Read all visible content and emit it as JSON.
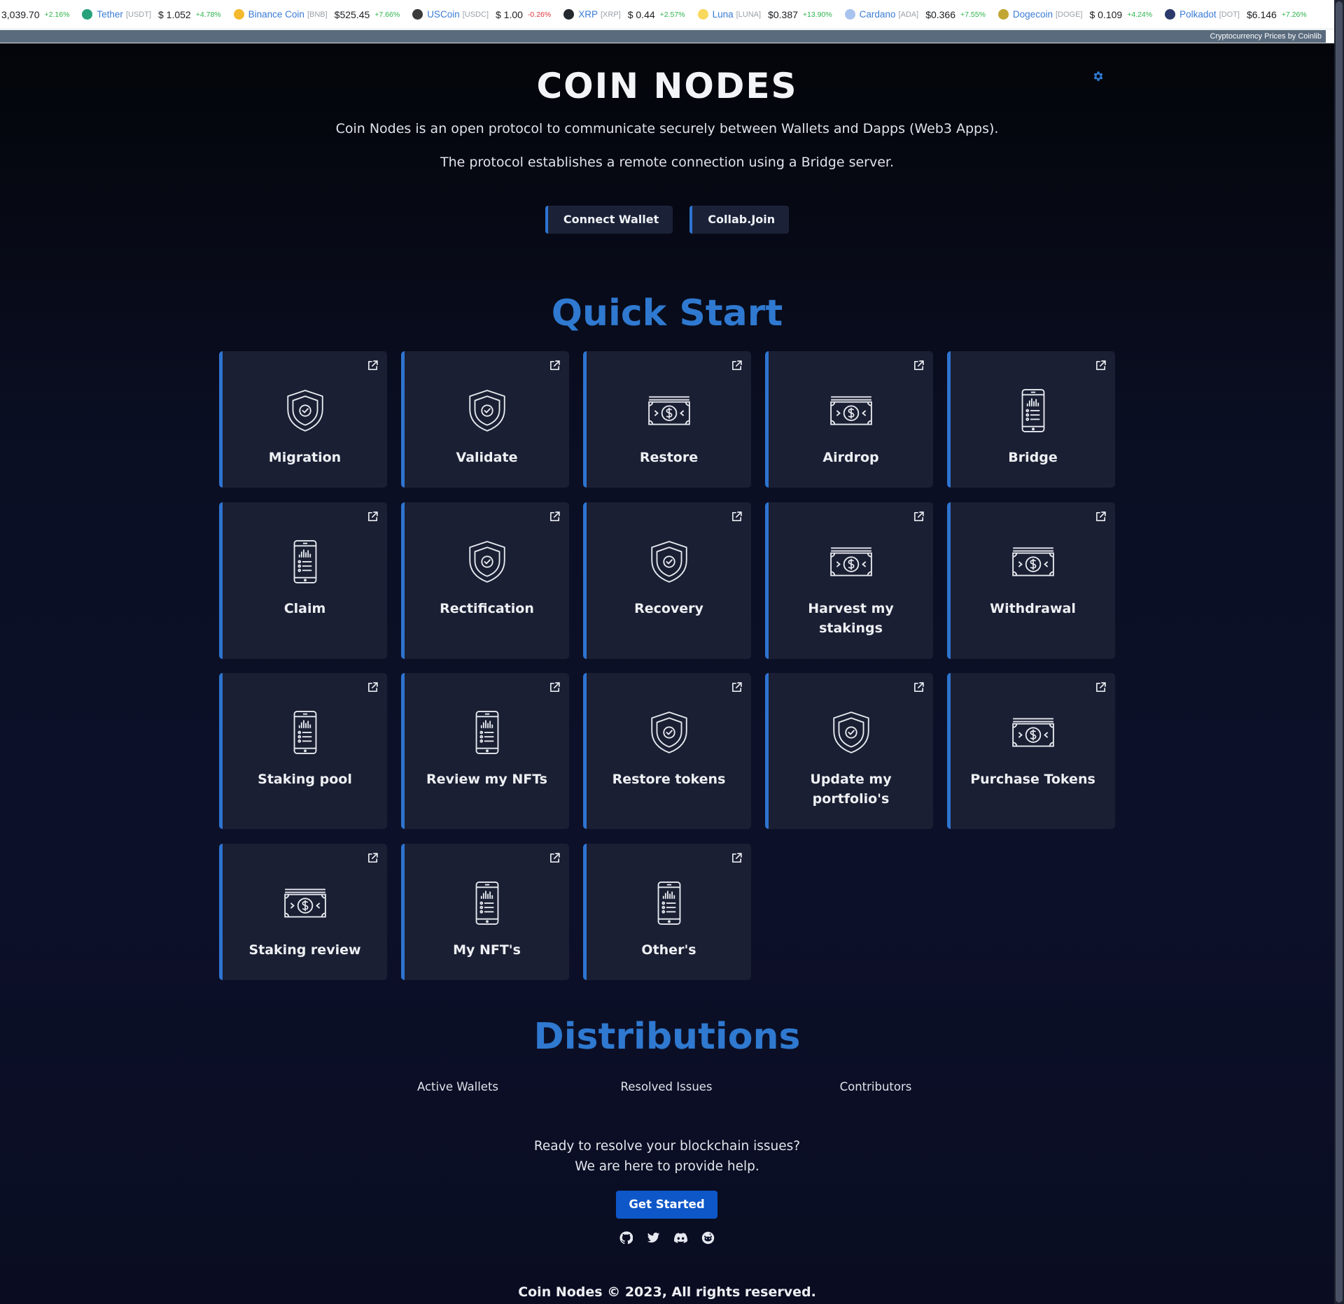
{
  "ticker": {
    "items": [
      {
        "name": "",
        "symbol": "",
        "price": "3,039.70",
        "change": "+2.16%",
        "dir": "up",
        "color": ""
      },
      {
        "name": "Tether",
        "symbol": "[USDT]",
        "price": "$ 1.052",
        "change": "+4.78%",
        "dir": "up",
        "color": "#26a17b"
      },
      {
        "name": "Binance Coin",
        "symbol": "[BNB]",
        "price": "$525.45",
        "change": "+7.66%",
        "dir": "up",
        "color": "#f3ba2f"
      },
      {
        "name": "USCoin",
        "symbol": "[USDC]",
        "price": "$ 1.00",
        "change": "-0.26%",
        "dir": "down",
        "color": "#3b3b3b"
      },
      {
        "name": "XRP",
        "symbol": "[XRP]",
        "price": "$ 0.44",
        "change": "+2.57%",
        "dir": "up",
        "color": "#23292f"
      },
      {
        "name": "Luna",
        "symbol": "[LUNA]",
        "price": "$0.387",
        "change": "+13.90%",
        "dir": "up",
        "color": "#f9d85e"
      },
      {
        "name": "Cardano",
        "symbol": "[ADA]",
        "price": "$0.366",
        "change": "+7.55%",
        "dir": "up",
        "color": "#a9c3ef"
      },
      {
        "name": "Dogecoin",
        "symbol": "[DOGE]",
        "price": "$ 0.109",
        "change": "+4.24%",
        "dir": "up",
        "color": "#c2a633"
      },
      {
        "name": "Polkadot",
        "symbol": "[DOT]",
        "price": "$6.146",
        "change": "+7.26%",
        "dir": "up",
        "color": "#2b3a6b"
      }
    ],
    "credit": "Cryptocurrency Prices by Coinlib"
  },
  "header": {
    "title": "COIN NODES",
    "tagline1": "Coin Nodes is an open protocol to communicate securely between Wallets and Dapps (Web3 Apps).",
    "tagline2": "The protocol establishes a remote connection using a Bridge server.",
    "connect_label": "Connect Wallet",
    "collab_label": "Collab.Join",
    "settings_icon": "gear-icon"
  },
  "quick_start": {
    "title": "Quick Start",
    "cards": [
      {
        "label": "Migration",
        "icon": "shield"
      },
      {
        "label": "Validate",
        "icon": "shield"
      },
      {
        "label": "Restore",
        "icon": "money"
      },
      {
        "label": "Airdrop",
        "icon": "money"
      },
      {
        "label": "Bridge",
        "icon": "phone"
      },
      {
        "label": "Claim",
        "icon": "phone"
      },
      {
        "label": "Rectification",
        "icon": "shield"
      },
      {
        "label": "Recovery",
        "icon": "shield"
      },
      {
        "label": "Harvest my stakings",
        "icon": "money"
      },
      {
        "label": "Withdrawal",
        "icon": "money"
      },
      {
        "label": "Staking pool",
        "icon": "phone"
      },
      {
        "label": "Review my NFTs",
        "icon": "phone"
      },
      {
        "label": "Restore tokens",
        "icon": "shield"
      },
      {
        "label": "Update my portfolio's",
        "icon": "shield"
      },
      {
        "label": "Purchase Tokens",
        "icon": "money"
      },
      {
        "label": "Staking review",
        "icon": "money"
      },
      {
        "label": "My NFT's",
        "icon": "phone"
      },
      {
        "label": "Other's",
        "icon": "phone"
      }
    ]
  },
  "distributions": {
    "title": "Distributions",
    "stats": [
      "Active Wallets",
      "Resolved Issues",
      "Contributors"
    ],
    "cta_line1": "Ready to resolve your blockchain issues?",
    "cta_line2": "We are here to provide help.",
    "get_started": "Get Started",
    "socials": [
      "github-icon",
      "twitter-icon",
      "discord-icon",
      "reddit-icon"
    ]
  },
  "footer": {
    "text": "Coin Nodes © 2023, All rights reserved."
  },
  "colors": {
    "accent": "#2e74d0",
    "primary_button": "#0e57c9",
    "card_bg": "#1a1f33"
  }
}
